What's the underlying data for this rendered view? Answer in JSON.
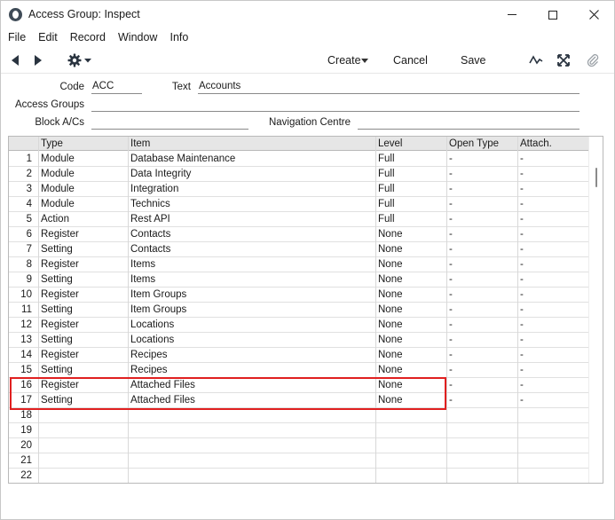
{
  "window": {
    "title": "Access Group: Inspect"
  },
  "menu": [
    "File",
    "Edit",
    "Record",
    "Window",
    "Info"
  ],
  "toolbar": {
    "create_label": "Create",
    "cancel_label": "Cancel",
    "save_label": "Save"
  },
  "fields": {
    "code_label": "Code",
    "code_value": "ACC",
    "text_label": "Text",
    "text_value": "Accounts",
    "access_groups_label": "Access Groups",
    "access_groups_value": "",
    "block_acs_label": "Block A/Cs",
    "block_acs_value": "",
    "nav_centre_label": "Navigation Centre",
    "nav_centre_value": ""
  },
  "grid": {
    "columns": [
      "",
      "Type",
      "Item",
      "Level",
      "Open Type",
      "Attach."
    ],
    "rows": [
      {
        "n": "1",
        "type": "Module",
        "item": "Database Maintenance",
        "level": "Full",
        "open": "-",
        "attach": "-"
      },
      {
        "n": "2",
        "type": "Module",
        "item": "Data Integrity",
        "level": "Full",
        "open": "-",
        "attach": "-"
      },
      {
        "n": "3",
        "type": "Module",
        "item": "Integration",
        "level": "Full",
        "open": "-",
        "attach": "-"
      },
      {
        "n": "4",
        "type": "Module",
        "item": "Technics",
        "level": "Full",
        "open": "-",
        "attach": "-"
      },
      {
        "n": "5",
        "type": "Action",
        "item": "Rest API",
        "level": "Full",
        "open": "-",
        "attach": "-"
      },
      {
        "n": "6",
        "type": "Register",
        "item": "Contacts",
        "level": "None",
        "open": "-",
        "attach": "-"
      },
      {
        "n": "7",
        "type": "Setting",
        "item": "Contacts",
        "level": "None",
        "open": "-",
        "attach": "-"
      },
      {
        "n": "8",
        "type": "Register",
        "item": "Items",
        "level": "None",
        "open": "-",
        "attach": "-"
      },
      {
        "n": "9",
        "type": "Setting",
        "item": "Items",
        "level": "None",
        "open": "-",
        "attach": "-"
      },
      {
        "n": "10",
        "type": "Register",
        "item": "Item Groups",
        "level": "None",
        "open": "-",
        "attach": "-"
      },
      {
        "n": "11",
        "type": "Setting",
        "item": "Item Groups",
        "level": "None",
        "open": "-",
        "attach": "-"
      },
      {
        "n": "12",
        "type": "Register",
        "item": "Locations",
        "level": "None",
        "open": "-",
        "attach": "-"
      },
      {
        "n": "13",
        "type": "Setting",
        "item": "Locations",
        "level": "None",
        "open": "-",
        "attach": "-"
      },
      {
        "n": "14",
        "type": "Register",
        "item": "Recipes",
        "level": "None",
        "open": "-",
        "attach": "-"
      },
      {
        "n": "15",
        "type": "Setting",
        "item": "Recipes",
        "level": "None",
        "open": "-",
        "attach": "-"
      },
      {
        "n": "16",
        "type": "Register",
        "item": "Attached Files",
        "level": "None",
        "open": "-",
        "attach": "-"
      },
      {
        "n": "17",
        "type": "Setting",
        "item": "Attached Files",
        "level": "None",
        "open": "-",
        "attach": "-"
      },
      {
        "n": "18",
        "type": "",
        "item": "",
        "level": "",
        "open": "",
        "attach": ""
      },
      {
        "n": "19",
        "type": "",
        "item": "",
        "level": "",
        "open": "",
        "attach": ""
      },
      {
        "n": "20",
        "type": "",
        "item": "",
        "level": "",
        "open": "",
        "attach": ""
      },
      {
        "n": "21",
        "type": "",
        "item": "",
        "level": "",
        "open": "",
        "attach": ""
      },
      {
        "n": "22",
        "type": "",
        "item": "",
        "level": "",
        "open": "",
        "attach": ""
      }
    ]
  },
  "colors": {
    "highlight": "#e02020",
    "header_bg": "#e6e6e6"
  }
}
